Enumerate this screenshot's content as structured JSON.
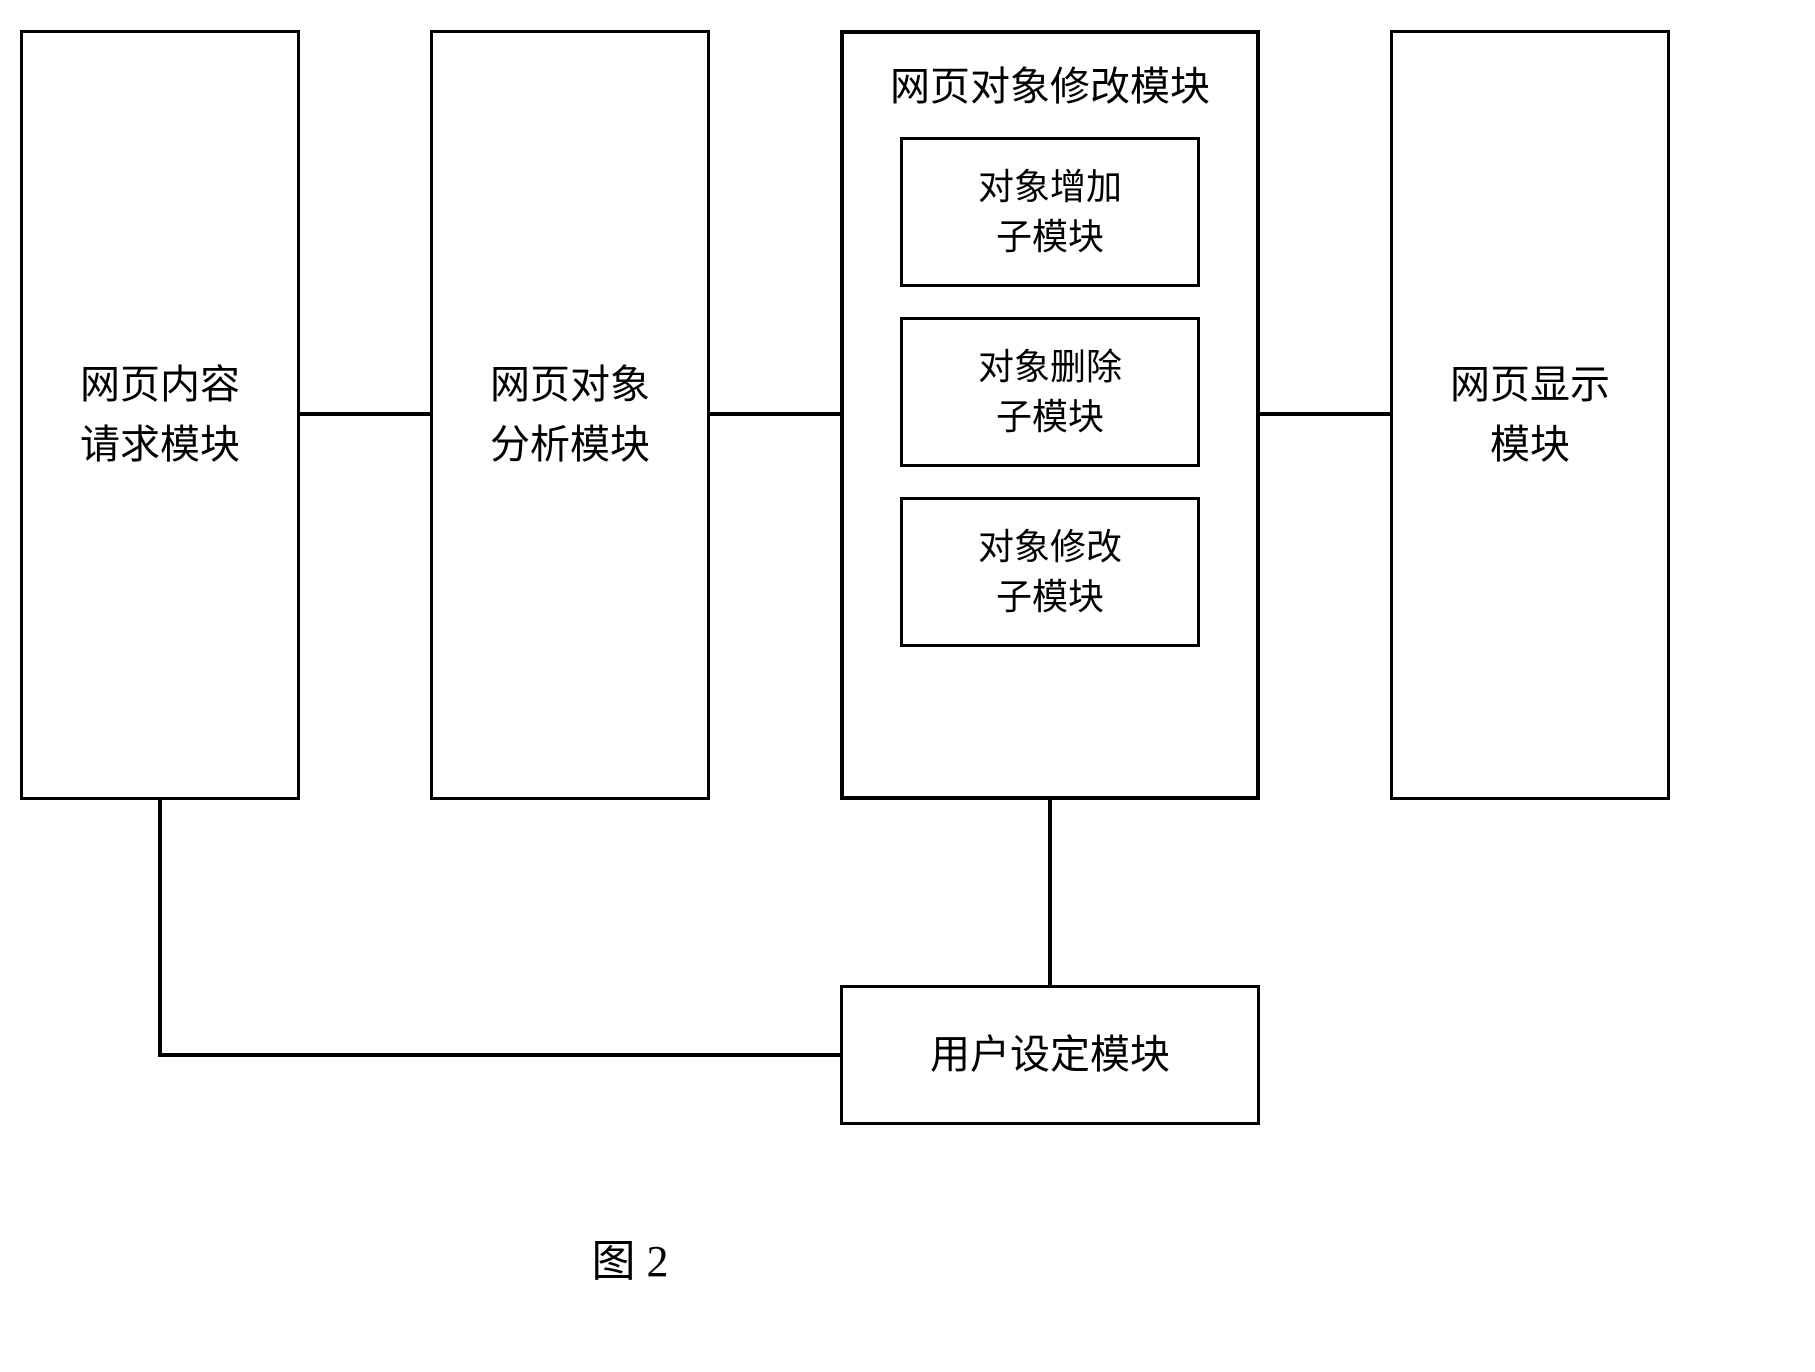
{
  "boxes": {
    "request": "网页内容\n请求模块",
    "analysis": "网页对象\n分析模块",
    "modify_title": "网页对象修改模块",
    "sub_add": "对象增加\n子模块",
    "sub_delete": "对象删除\n子模块",
    "sub_modify": "对象修改\n子模块",
    "display": "网页显示\n模块",
    "user_setting": "用户设定模块"
  },
  "caption": "图 2"
}
